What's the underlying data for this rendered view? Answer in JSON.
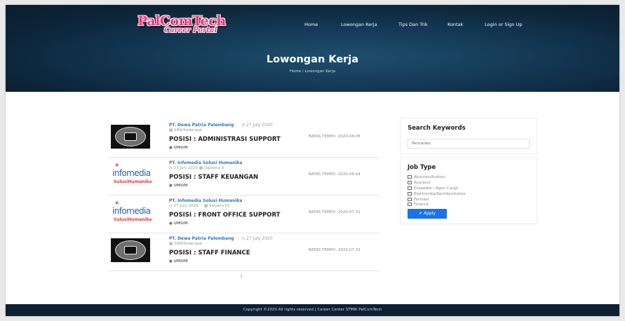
{
  "header": {
    "logo_main": "PalComTech",
    "logo_sub": "Career Portal",
    "nav": [
      "Home",
      "Lowongan Kerja",
      "Tips Dan Trik",
      "Kontak",
      "Login or Sign Up"
    ]
  },
  "hero": {
    "title": "Lowongan Kerja",
    "breadcrumb": "Home / Lowongan Kerja"
  },
  "jobs": [
    {
      "logo": "dewa-patria-logo",
      "company": "PT. Dewa Patria Palembang",
      "date": "27 July 2020",
      "education": "SMA/Sederajat",
      "position": "POSISI : ADMINISTRASI SUPPORT",
      "category": "UMUM",
      "deadline": "BATAS TEMPO :2020-08-05"
    },
    {
      "logo": "infomedia-logo",
      "company": "PT. Infomedia Solusi Humanika",
      "date": "27 July 2020",
      "education": "Diploma 3",
      "position": "POSISI : STAFF KEUANGAN",
      "category": "UMUM",
      "deadline": "BATAS TEMPO :2020-08-04"
    },
    {
      "logo": "infomedia-logo",
      "company": "PT. Infomedia Solusi Humanika",
      "date": "27-July-2020",
      "education": "Sarjana S1",
      "position": "POSISI : FRONT OFFICE SUPPORT",
      "category": "UMUM",
      "deadline": "BATAS TEMPO :2020-07-31"
    },
    {
      "logo": "dewa-patria-logo",
      "company": "PT. Dewa Patria Palembang",
      "date": "27 July 2020",
      "education": "SMA/Sederajat",
      "position": "POSISI : STAFF FINANCE",
      "category": "UMUM",
      "deadline": "BATAS TEMPO :2020-07-31"
    }
  ],
  "logos": {
    "infomedia_word": "infomedia",
    "infomedia_sub": "SolusiHumanika"
  },
  "pagination": {
    "current": "1"
  },
  "search": {
    "title": "Search Keywords",
    "placeholder": "Pencarian"
  },
  "job_type": {
    "title": "Job Type",
    "options": [
      "Akuntan/Auditor",
      "Asuransi",
      "Ekspedisi / Agen Cargo",
      "Elektronika/Semikonduktor",
      "Farmasi",
      "Finance"
    ],
    "apply_label": "✔ Apply"
  },
  "footer": {
    "text": "Copyright ©2020 All rights reserved | Career Center STMIK PalComTech"
  },
  "colors": {
    "hero_bg": "#143955",
    "accent": "#1a73e8",
    "link": "#2b79c2",
    "logo_pink": "#ff2f7a"
  }
}
